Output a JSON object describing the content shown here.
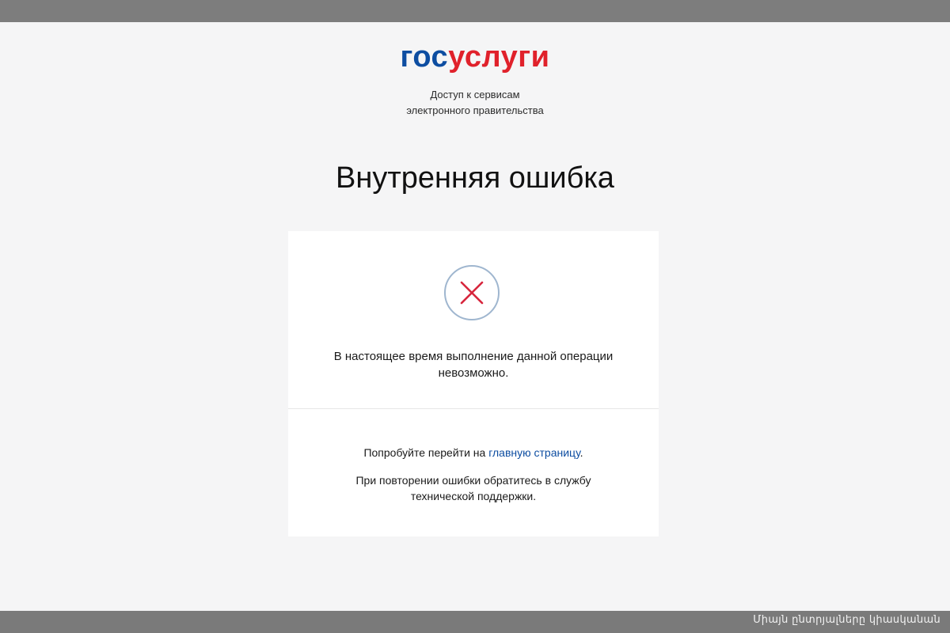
{
  "logo": {
    "part1": "гос",
    "part2": "услуги"
  },
  "tagline": {
    "line1": "Доступ к сервисам",
    "line2": "электронного правительства"
  },
  "page_title": "Внутренняя ошибка",
  "error": {
    "icon": "close-circle-icon",
    "message_line1": "В настоящее время выполнение данной операции",
    "message_line2": "невозможно."
  },
  "hint": {
    "prefix": "Попробуйте перейти на ",
    "link_text": "главную страницу",
    "suffix": "."
  },
  "support": {
    "line1": "При повторении ошибки обратитесь в службу",
    "line2": "технической поддержки."
  },
  "caption": "Միայն ընտրյալները կիասկանան",
  "colors": {
    "brand_blue": "#0d4da1",
    "brand_red": "#e0212b",
    "error_red": "#d7263d",
    "icon_ring": "#9fb6cf"
  }
}
